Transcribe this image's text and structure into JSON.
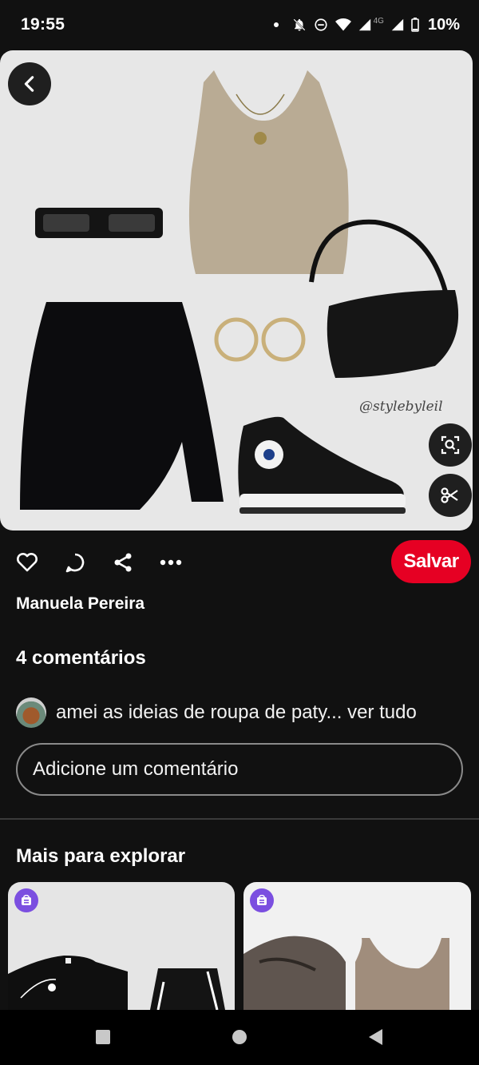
{
  "status_bar": {
    "time": "19:55",
    "battery": "10%",
    "network_label": "4G",
    "icons": [
      "notifications-off-icon",
      "do-not-disturb-icon",
      "wifi-icon",
      "signal-icon",
      "signal-icon",
      "battery-icon"
    ]
  },
  "pin": {
    "watermark": "@stylebyleil",
    "back_icon": "chevron-left-icon",
    "visual_search_icon": "lens-icon",
    "cutout_icon": "scissors-icon"
  },
  "actions": {
    "icons": [
      "heart-icon",
      "comment-icon",
      "share-icon",
      "more-icon"
    ],
    "save_label": "Salvar"
  },
  "author": {
    "name": "Manuela Pereira"
  },
  "comments": {
    "count_label": "4 comentários",
    "preview_text": "amei as ideias de roupa de paty... ver tudo",
    "input_placeholder": "Adicione um comentário"
  },
  "explore": {
    "title": "Mais para explorar"
  },
  "nav": {
    "icons": [
      "recents-icon",
      "home-icon",
      "back-icon"
    ]
  },
  "colors": {
    "background": "#111111",
    "accent": "#e60023",
    "shop_badge": "#7b4fe0"
  }
}
